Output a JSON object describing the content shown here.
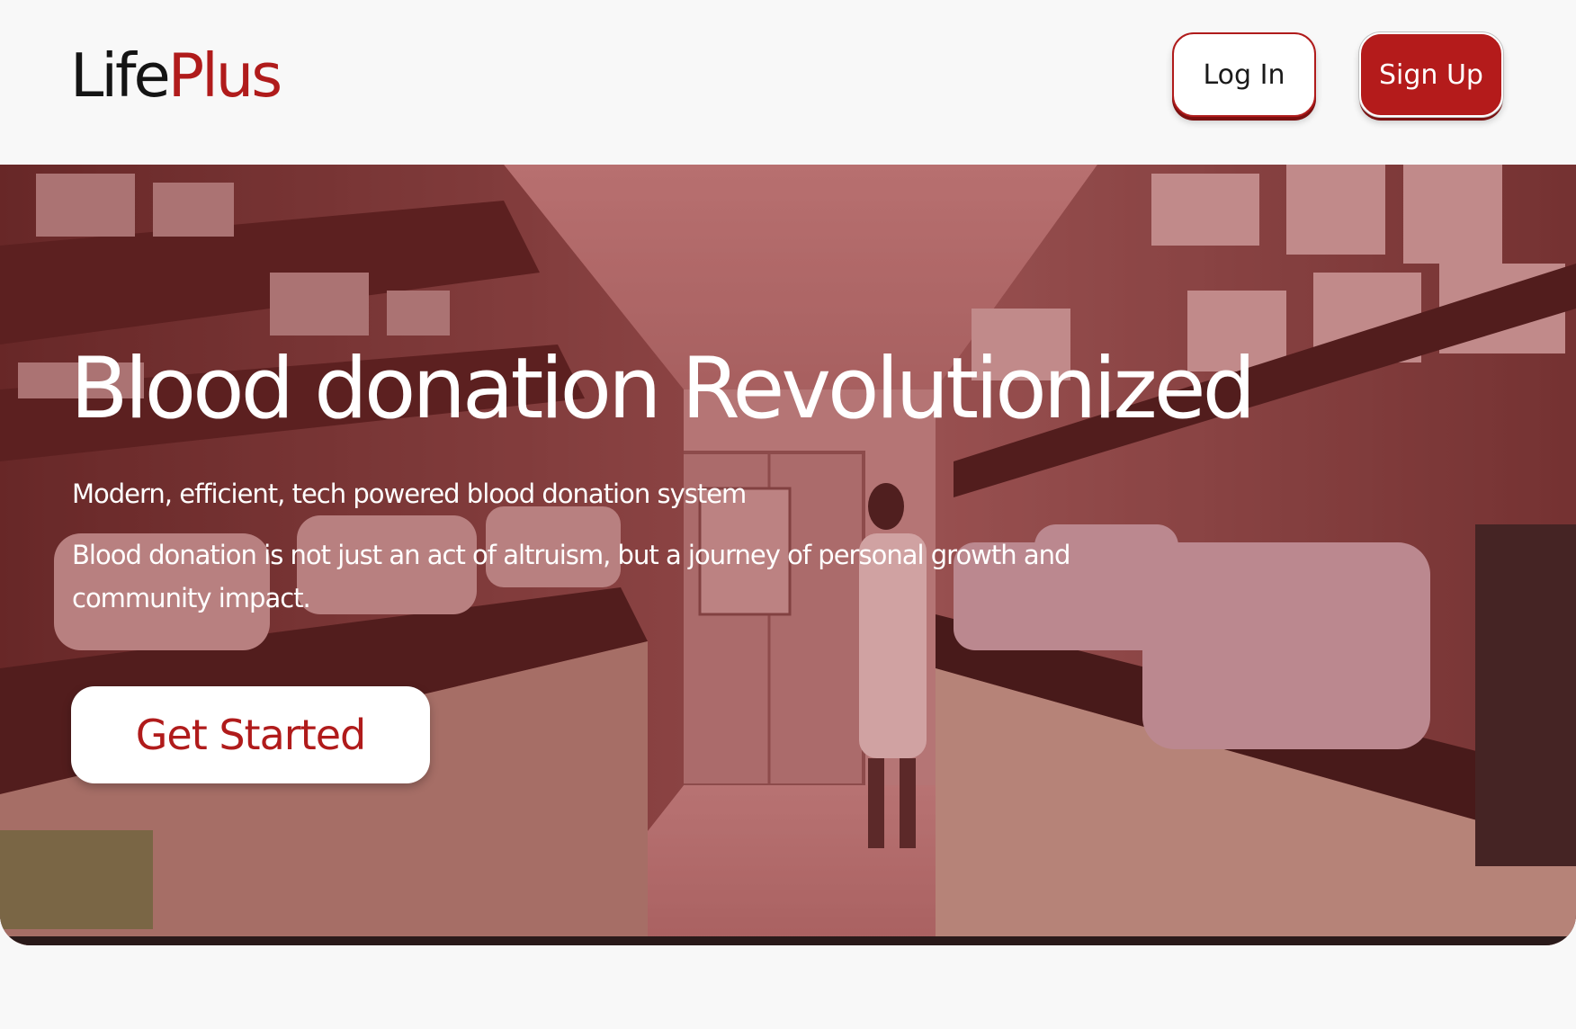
{
  "brand": {
    "name_part1": "Life",
    "name_part2": "Plus",
    "primary_color": "#b01b1b",
    "dark_text_color": "#141414"
  },
  "header": {
    "login_label": "Log In",
    "signup_label": "Sign Up"
  },
  "hero": {
    "title": "Blood donation Revolutionized",
    "subtitle": "Modern, efficient, tech powered blood donation system",
    "description": "Blood donation is not just an act of altruism, but a journey of personal growth and community impact.",
    "cta_label": "Get Started",
    "background_image": "laboratory-photo"
  }
}
